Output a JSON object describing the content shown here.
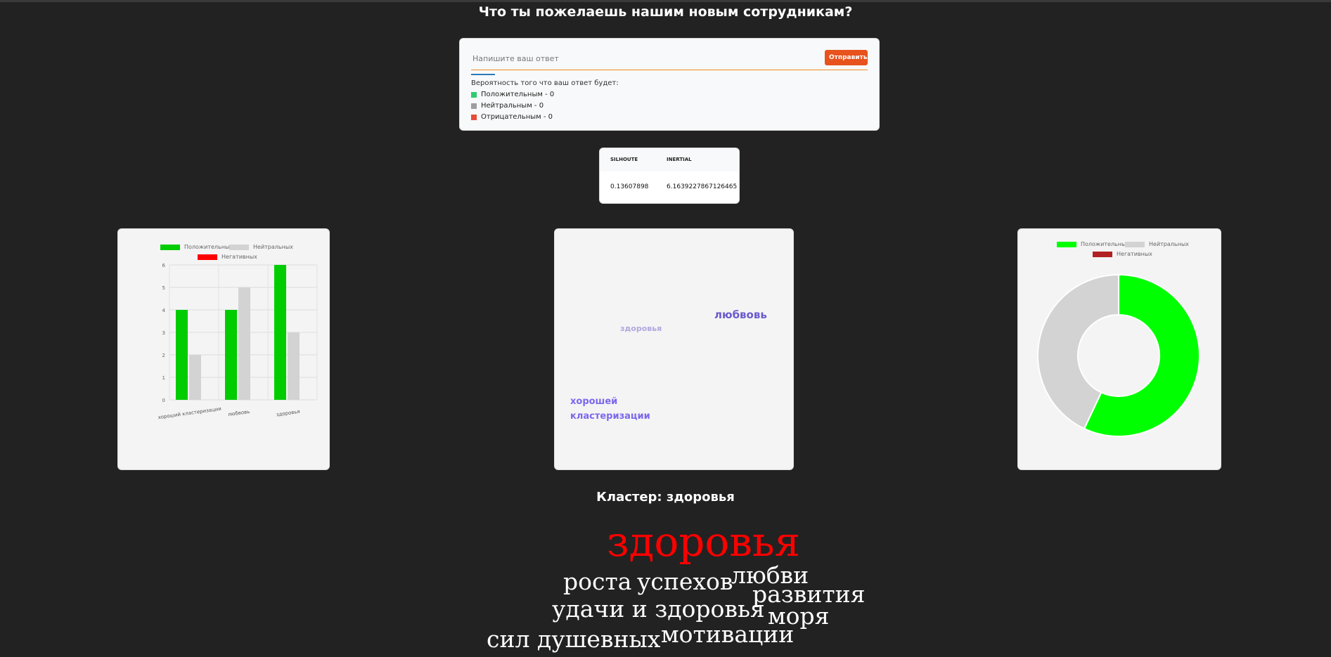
{
  "question": "Что ты пожелаешь нашим новым сотрудникам?",
  "form": {
    "placeholder": "Напишите ваш ответ",
    "submit_label": "Отправить",
    "probability_title": "Вероятность того что ваш ответ будет:",
    "probabilities": [
      {
        "label": "Положительным - 0",
        "color": "#2ecc71"
      },
      {
        "label": "Нейтральным - 0",
        "color": "#9e9e9e"
      },
      {
        "label": "Отрицательным - 0",
        "color": "#e74c3c"
      }
    ]
  },
  "metrics": {
    "headers": [
      "SILHOUTE",
      "INERTIAL"
    ],
    "values": [
      "0.13607898",
      "6.1639227867126465"
    ]
  },
  "bar_legend": [
    "Положительных",
    "Нейтральных",
    "Негативных"
  ],
  "word_cloud_panel": [
    "любвовь",
    "здоровья",
    "хорошей",
    "кластеризации"
  ],
  "donut_legend": [
    "Положительных",
    "Нейтральных",
    "Негативных"
  ],
  "colors": {
    "positive": "#00cc00",
    "neutral": "#d3d3d3",
    "negative": "#ff0000",
    "donut_positive": "#00ff00",
    "donut_negative": "#b22222",
    "accent": "#e8521c"
  },
  "chart_data": [
    {
      "type": "bar",
      "categories": [
        "хороший кластеризации",
        "любвовь",
        "здоровья"
      ],
      "series": [
        {
          "name": "Положительных",
          "values": [
            4,
            4,
            6
          ]
        },
        {
          "name": "Нейтральных",
          "values": [
            2,
            5,
            3
          ]
        },
        {
          "name": "Негативных",
          "values": [
            0,
            0,
            0
          ]
        }
      ],
      "yticks": [
        "0",
        "1",
        "2",
        "3",
        "4",
        "5",
        "6"
      ],
      "ylim": [
        0,
        6
      ],
      "legend": "top"
    },
    {
      "type": "pie",
      "labels": [
        "Положительных",
        "Нейтральных",
        "Негативных"
      ],
      "values": [
        57,
        43,
        0
      ],
      "legend": "top"
    }
  ],
  "cluster": {
    "title": "Кластер: здоровья",
    "words": [
      "здоровья",
      "роста",
      "успехов",
      "любви",
      "развития",
      "удачи и здоровья",
      "моря",
      "сил душевных",
      "мотивации"
    ]
  }
}
